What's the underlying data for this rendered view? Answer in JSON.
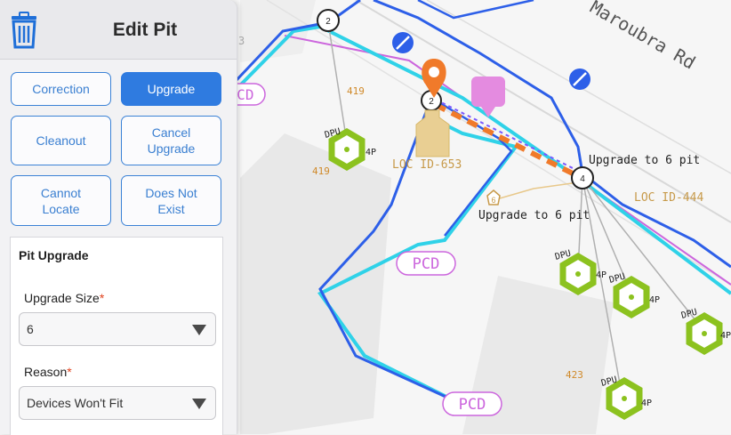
{
  "map": {
    "street": "Maroubra Rd",
    "pcd_label": "PCD",
    "loc_labels": [
      "LOC ID-653",
      "LOC ID-444"
    ],
    "upgrade_note": "Upgrade to 6 pit",
    "dpu_label": "DPU",
    "port_label": "4P",
    "lot_numbers": [
      "419",
      "419",
      "423"
    ],
    "pit_numbers": [
      "2",
      "2",
      "4"
    ],
    "small_pit": "6",
    "edge_fragment": "3"
  },
  "panel": {
    "title": "Edit Pit",
    "buttons": [
      {
        "label": "Correction",
        "active": false
      },
      {
        "label": "Upgrade",
        "active": true
      },
      {
        "label": "Cleanout",
        "active": false
      },
      {
        "label": "Cancel Upgrade",
        "active": false
      },
      {
        "label": "Cannot Locate",
        "active": false
      },
      {
        "label": "Does Not Exist",
        "active": false
      }
    ],
    "section_title": "Pit Upgrade",
    "upgrade_size": {
      "label": "Upgrade Size",
      "required_mark": "*",
      "value": "6"
    },
    "reason": {
      "label": "Reason",
      "required_mark": "*",
      "value": "Devices Won't Fit"
    }
  },
  "colors": {
    "accent": "#2f7be0",
    "route_blue": "#2d5fe8",
    "cyan": "#2fd2e8",
    "magenta": "#cc66dd",
    "dpu_green": "#8cc21f",
    "marker_orange": "#f07a2a",
    "annotation_brown": "#c79a4a"
  }
}
